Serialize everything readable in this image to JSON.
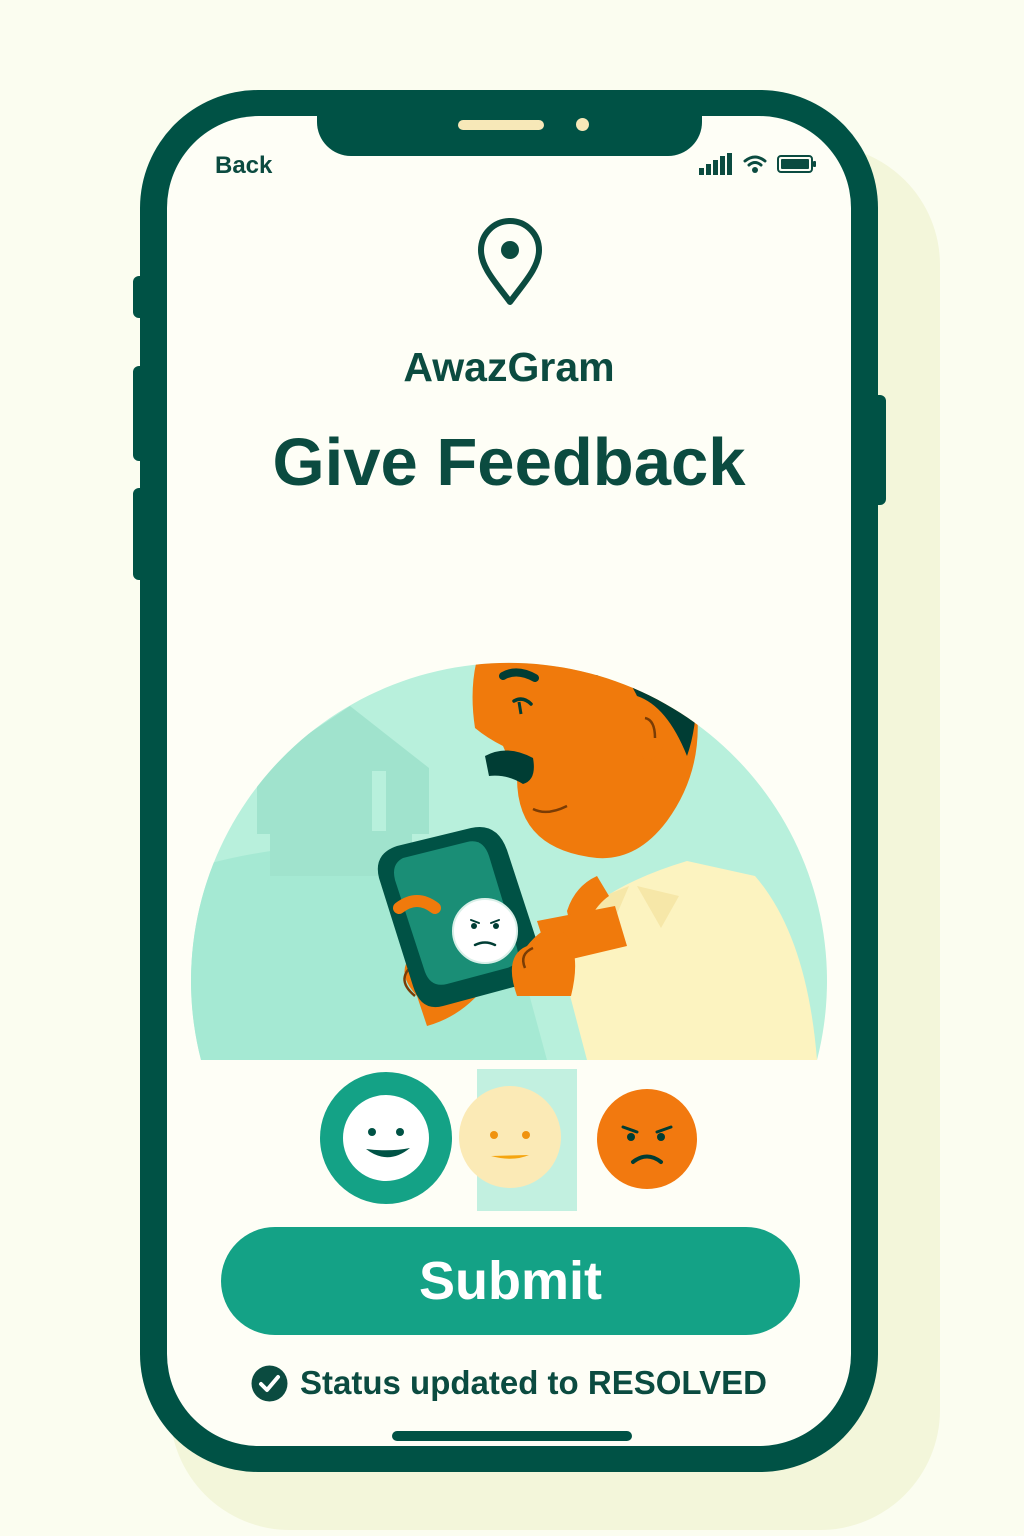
{
  "header": {
    "back_label": "Back",
    "icons": [
      "signal-icon",
      "wifi-icon",
      "battery-icon"
    ]
  },
  "brand": {
    "logo_icon": "location-pin-icon",
    "app_name": "AwazGram"
  },
  "page": {
    "title": "Give Feedback"
  },
  "illustration": {
    "subject": "man-holding-phone-illustration",
    "phone_screen_icon": "neutral-face-icon"
  },
  "rating": {
    "options": [
      {
        "icon": "happy-face-icon",
        "selected": true
      },
      {
        "icon": "neutral-face-icon",
        "selected": false
      },
      {
        "icon": "angry-face-icon",
        "selected": false
      }
    ]
  },
  "actions": {
    "submit_label": "Submit"
  },
  "status": {
    "icon": "check-circle-icon",
    "text": "Status updated to RESOLVED"
  },
  "colors": {
    "brand_dark": "#005245",
    "accent": "#14a286",
    "mint": "#b8f0dc",
    "skin": "#f07a0c",
    "shirt": "#fcf3c0",
    "neutral_face": "#fbeab6",
    "angry_face": "#f2790f"
  }
}
